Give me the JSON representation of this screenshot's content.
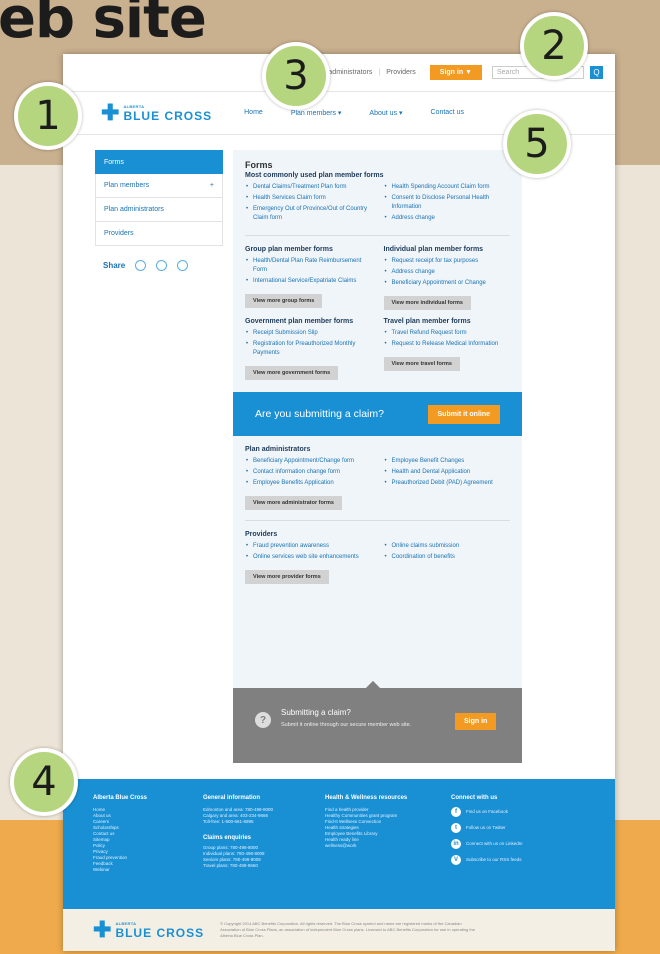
{
  "heading": "eb site",
  "utility": {
    "link1": "Plan administrators",
    "link2": "Providers",
    "signin": "Sign in ▼",
    "search_placeholder": "Search",
    "go": "Q"
  },
  "header": {
    "logo_small": "ALBERTA",
    "logo_big": "BLUE CROSS",
    "nav": [
      "Home",
      "Plan members ▾",
      "About us ▾",
      "Contact us"
    ]
  },
  "sidebar": {
    "items": [
      {
        "label": "Forms",
        "active": true
      },
      {
        "label": "Plan members",
        "arrow": "+"
      },
      {
        "label": "Plan administrators"
      },
      {
        "label": "Providers"
      }
    ],
    "share": "Share"
  },
  "main": {
    "forms_title": "Forms",
    "common_title": "Most commonly used plan member forms",
    "common_left": [
      "Dental Claims/Treatment Plan form",
      "Health Services Claim form",
      "Emergency Out of Province/Out of Country Claim form"
    ],
    "common_right": [
      "Health Spending Account Claim form",
      "Consent to Disclose Personal Health Information",
      "Address change"
    ],
    "group_title": "Group plan member forms",
    "group_links": [
      "Health/Dental Plan Rate Reimbursement Form",
      "International Service/Expatriate Claims"
    ],
    "group_btn": "View more group forms",
    "indiv_title": "Individual plan member forms",
    "indiv_links": [
      "Request receipt for tax purposes",
      "Address change",
      "Beneficiary Appointment or Change"
    ],
    "indiv_btn": "View more individual forms",
    "gov_title": "Government plan member forms",
    "gov_links": [
      "Receipt Submission Slip",
      "Registration for Preauthorized Monthly Payments"
    ],
    "gov_btn": "View more government forms",
    "travel_title": "Travel plan member forms",
    "travel_links": [
      "Travel Refund Request form",
      "Request to Release Medical Information"
    ],
    "travel_btn": "View more travel forms",
    "banner_text": "Are you submitting a claim?",
    "banner_btn": "Submit it online",
    "admin_title": "Plan administrators",
    "admin_left": [
      "Beneficiary Appointment/Change form",
      "Contact information change form",
      "Employee Benefits Application"
    ],
    "admin_right": [
      "Employee Benefit Changes",
      "Health and Dental Application",
      "Preauthorized Debit (PAD) Agreement"
    ],
    "admin_btn": "View more administrator forms",
    "prov_title": "Providers",
    "prov_left": [
      "Fraud prevention awareness",
      "Online services web site enhancements"
    ],
    "prov_right": [
      "Online claims submission",
      "Coordination of benefits"
    ],
    "prov_btn": "View more provider forms",
    "grey_title": "Submitting a claim?",
    "grey_text": "Submit it online through our secure member web site.",
    "grey_btn": "Sign in"
  },
  "footer": {
    "col1_title": "Alberta Blue Cross",
    "col1_items": [
      "Home",
      "About us",
      "Careers",
      "Scholarships",
      "Contact us",
      "Sitemap",
      "Policy",
      "Privacy",
      "Fraud prevention",
      "Feedback",
      "Webinar"
    ],
    "col2_title": "General information",
    "col2_items": [
      "Edmonton and area: 780-498-8000",
      "Calgary and area: 403-234-9666",
      "Toll-free: 1-800-661-6995"
    ],
    "col2_sub": "Claims enquiries",
    "col2_sub_items": [
      "Group plans: 780-498-8000",
      "Individual plans: 780-498-8008",
      "Seniors plans: 780-498-8008",
      "Travel plans: 780-498-8660"
    ],
    "col3_title": "Health & Wellness resources",
    "col3_items": [
      "Find a health provider",
      "Healthy Communities grant program",
      "Find-It Wellness Connection",
      "Health strategies",
      "Employee Benefits Library",
      "Health ready line",
      "wellness@work"
    ],
    "col4_title": "Connect with us",
    "col4_items": [
      "Find us on Facebook",
      "Follow us on Twitter",
      "Connect with us on LinkedIn",
      "Subscribe to our RSS feeds"
    ]
  },
  "bottom": {
    "logo_small": "ALBERTA",
    "logo_big": "BLUE CROSS",
    "copyright": "© Copyright 2014 ABC Benefits Corporation. All rights reserved. The Blue Cross symbol and name are registered marks of the Canadian Association of Blue Cross Plans, an association of independent Blue Cross plans. Licensed to ABC Benefits Corporation for use in operating the Alberta Blue Cross Plan."
  },
  "callouts": [
    "1",
    "2",
    "3",
    "4",
    "5"
  ]
}
